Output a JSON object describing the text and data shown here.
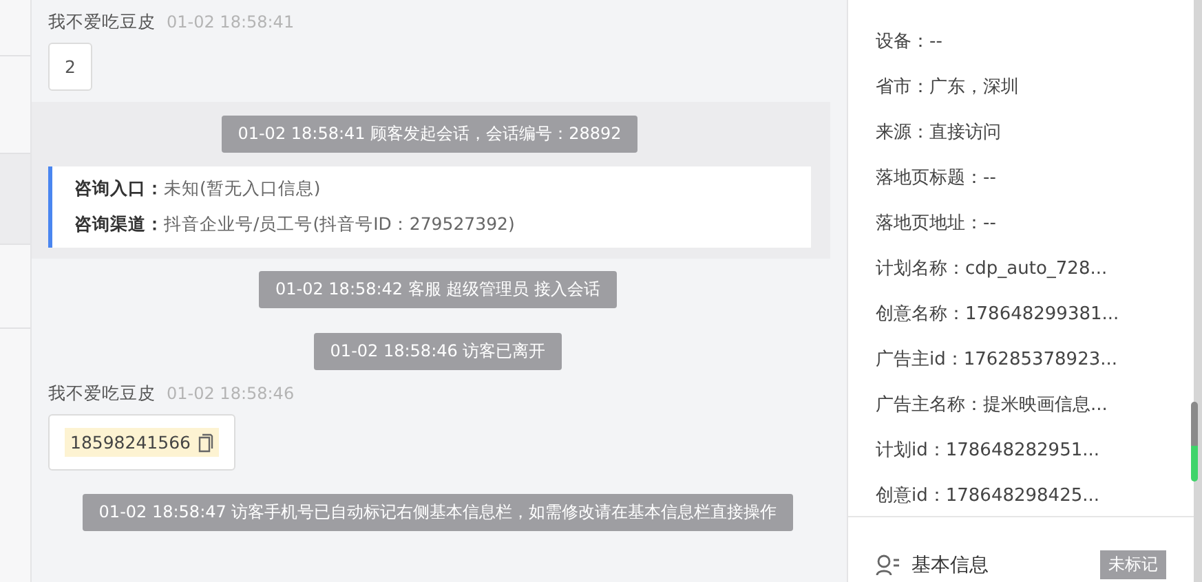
{
  "chat": [
    {
      "kind": "message",
      "sender": "我不爱吃豆皮",
      "time": "01-02 18:58:41",
      "text": "2"
    },
    {
      "kind": "session",
      "notice": "01-02 18:58:41 顾客发起会话，会话编号：28892",
      "fields": [
        {
          "label": "咨询入口：",
          "value": "未知(暂无入口信息)"
        },
        {
          "label": "咨询渠道：",
          "value": "抖音企业号/员工号(抖音号ID：279527392)"
        }
      ]
    },
    {
      "kind": "notice",
      "text": "01-02 18:58:42 客服 超级管理员 接入会话"
    },
    {
      "kind": "notice",
      "text": "01-02 18:58:46 访客已离开"
    },
    {
      "kind": "phone",
      "sender": "我不爱吃豆皮",
      "time": "01-02 18:58:46",
      "text": "18598241566"
    },
    {
      "kind": "notice",
      "text": "01-02 18:58:47 访客手机号已自动标记右侧基本信息栏，如需修改请在基本信息栏直接操作"
    }
  ],
  "info": [
    "设备：--",
    "省市：广东，深圳",
    "来源：直接访问",
    "落地页标题：--",
    "落地页地址：--",
    "计划名称：cdp_auto_728...",
    "创意名称：178648299381...",
    "广告主id：176285378923...",
    "广告主名称：提米映画信息...",
    "计划id：178648282951...",
    "创意id：178648298425..."
  ],
  "basic": {
    "title": "基本信息",
    "tag": "未标记"
  }
}
